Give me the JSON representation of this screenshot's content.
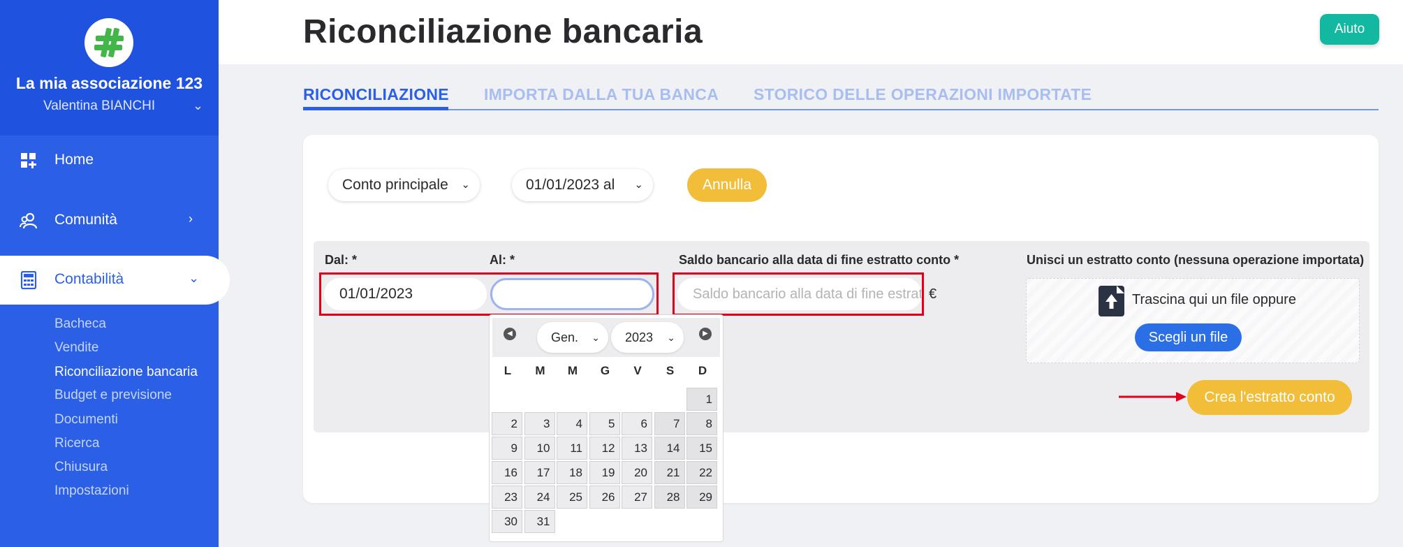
{
  "sidebar": {
    "org_name": "La mia associazione 123",
    "user_name": "Valentina BIANCHI",
    "nav": [
      {
        "label": "Home",
        "icon": "dashboard-icon"
      },
      {
        "label": "Comunità",
        "icon": "users-icon"
      },
      {
        "label": "Contabilità",
        "icon": "calculator-icon"
      }
    ],
    "subnav": [
      "Bacheca",
      "Vendite",
      "Riconciliazione bancaria",
      "Budget e previsione",
      "Documenti",
      "Ricerca",
      "Chiusura",
      "Impostazioni"
    ],
    "current_subnav": "Riconciliazione bancaria"
  },
  "header": {
    "title": "Riconciliazione bancaria",
    "help_label": "Aiuto"
  },
  "tabs": [
    "RICONCILIAZIONE",
    "IMPORTA DALLA TUA BANCA",
    "STORICO DELLE OPERAZIONI IMPORTATE"
  ],
  "filters": {
    "account": "Conto principale",
    "period": "01/01/2023 al",
    "cancel_label": "Annulla"
  },
  "form": {
    "from_label": "Dal: *",
    "from_value": "01/01/2023",
    "to_label": "Al: *",
    "to_value": "",
    "balance_label": "Saldo bancario alla data di fine estratto conto *",
    "balance_placeholder": "Saldo bancario alla data di fine estratto conto",
    "currency": "€",
    "merge_label": "Unisci un estratto conto (nessuna operazione importata)",
    "drop_text": "Trascina qui un file oppure",
    "choose_file_label": "Scegli un file",
    "create_label": "Crea l'estratto conto"
  },
  "calendar": {
    "month": "Gen.",
    "year": "2023",
    "weekdays": [
      "L",
      "M",
      "M",
      "G",
      "V",
      "S",
      "D"
    ],
    "days": [
      "1",
      "2",
      "3",
      "4",
      "5",
      "6",
      "7",
      "8",
      "9",
      "10",
      "11",
      "12",
      "13",
      "14",
      "15",
      "16",
      "17",
      "18",
      "19",
      "20",
      "21",
      "22",
      "23",
      "24",
      "25",
      "26",
      "27",
      "28",
      "29",
      "30",
      "31"
    ]
  },
  "colors": {
    "brand_blue": "#2a5fe6",
    "accent_yellow": "#f2bd39",
    "help_teal": "#13b8a0",
    "highlight_red": "#e2001a"
  }
}
